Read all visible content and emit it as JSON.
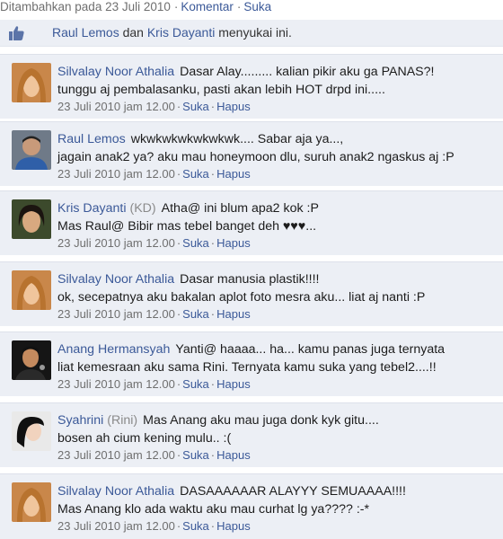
{
  "post_meta": {
    "added_text": "Ditambahkan pada 23 Juli 2010",
    "comment_link": "Komentar",
    "like_link": "Suka"
  },
  "likes": {
    "user1": "Raul Lemos",
    "connector": "dan",
    "user2": "Kris Dayanti",
    "suffix": "menyukai ini."
  },
  "comments": [
    {
      "author": "Silvalay Noor Athalia",
      "alias": "",
      "line1": "Dasar Alay......... kalian pikir  aku ga PANAS?!",
      "line2": "tunggu aj pembalasanku, pasti akan lebih HOT drpd ini.....",
      "time": "23 Juli 2010 jam 12.00",
      "like": "Suka",
      "delete": "Hapus"
    },
    {
      "author": "Raul Lemos",
      "alias": "",
      "line1": "wkwkwkwkwkwkwk.... Sabar aja ya...,",
      "line2": "jagain anak2 ya? aku mau honeymoon dlu, suruh anak2 ngaskus aj :P",
      "time": "23 Juli 2010 jam 12.00",
      "like": "Suka",
      "delete": "Hapus"
    },
    {
      "author": "Kris Dayanti",
      "alias": "(KD)",
      "line1": "Atha@  ini blum apa2 kok :P",
      "line2": "Mas Raul@ Bibir mas tebel banget deh ♥♥♥...",
      "time": "23 Juli 2010 jam 12.00",
      "like": "Suka",
      "delete": "Hapus"
    },
    {
      "author": "Silvalay Noor Athalia",
      "alias": "",
      "line1": "Dasar manusia plastik!!!!",
      "line2": "ok, secepatnya aku bakalan aplot foto mesra aku... liat aj nanti :P",
      "time": "23 Juli 2010 jam 12.00",
      "like": "Suka",
      "delete": "Hapus"
    },
    {
      "author": "Anang Hermansyah",
      "alias": "",
      "line1": "Yanti@ haaaa... ha... kamu panas juga ternyata",
      "line2": "liat kemesraan aku sama Rini. Ternyata kamu suka yang tebel2....!!",
      "time": "23 Juli 2010 jam 12.00",
      "like": "Suka",
      "delete": "Hapus"
    },
    {
      "author": "Syahrini",
      "alias": "(Rini)",
      "line1": "Mas Anang aku mau juga donk kyk gitu....",
      "line2": "bosen ah cium kening mulu.. :(",
      "time": "23 Juli 2010 jam 12.00",
      "like": "Suka",
      "delete": "Hapus"
    },
    {
      "author": "Silvalay Noor Athalia",
      "alias": "",
      "line1": "DASAAAAAAR ALAYYY SEMUAAAA!!!!",
      "line2": "Mas Anang klo ada waktu aku mau curhat lg ya???? :-*",
      "time": "23 Juli 2010 jam 12.00",
      "like": "Suka",
      "delete": "Hapus"
    }
  ]
}
